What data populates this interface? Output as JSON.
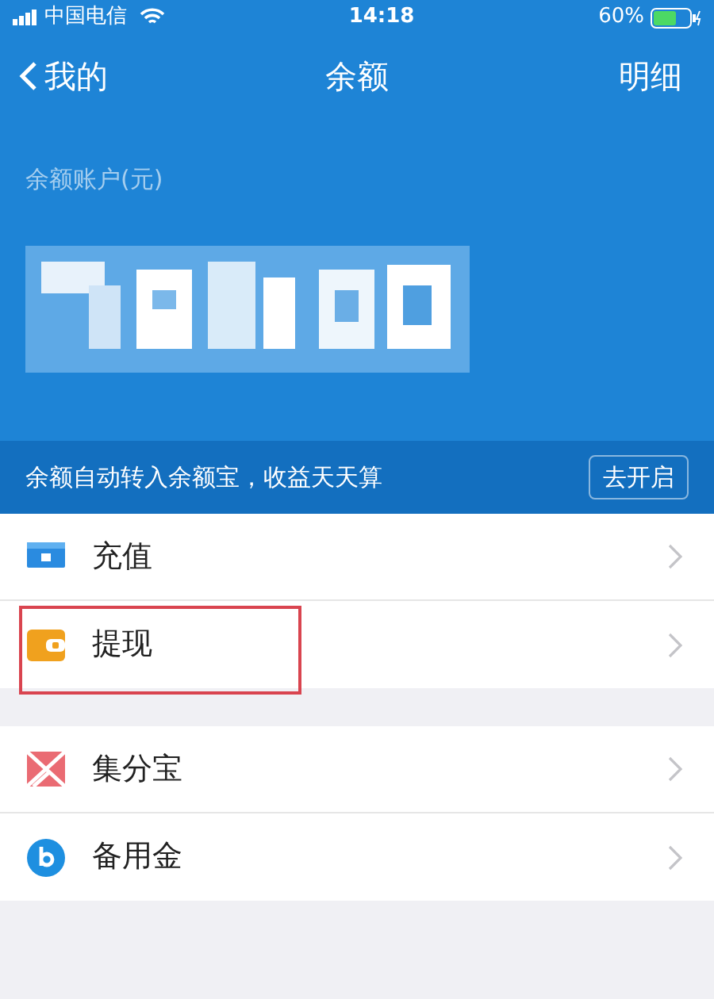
{
  "status_bar": {
    "carrier": "中国电信",
    "time": "14:18",
    "battery": "60%"
  },
  "nav": {
    "back": "我的",
    "title": "余额",
    "action": "明细"
  },
  "balance": {
    "label": "余额账户(元)"
  },
  "banner": {
    "text": "余额自动转入余额宝，收益天天算",
    "button": "去开启"
  },
  "groups": [
    {
      "items": [
        {
          "label": "充值",
          "kind": "topup",
          "highlighted": false
        },
        {
          "label": "提现",
          "kind": "withdraw",
          "highlighted": true
        }
      ]
    },
    {
      "items": [
        {
          "label": "集分宝",
          "kind": "points",
          "highlighted": false
        },
        {
          "label": "备用金",
          "kind": "reserve",
          "highlighted": false
        }
      ]
    }
  ]
}
